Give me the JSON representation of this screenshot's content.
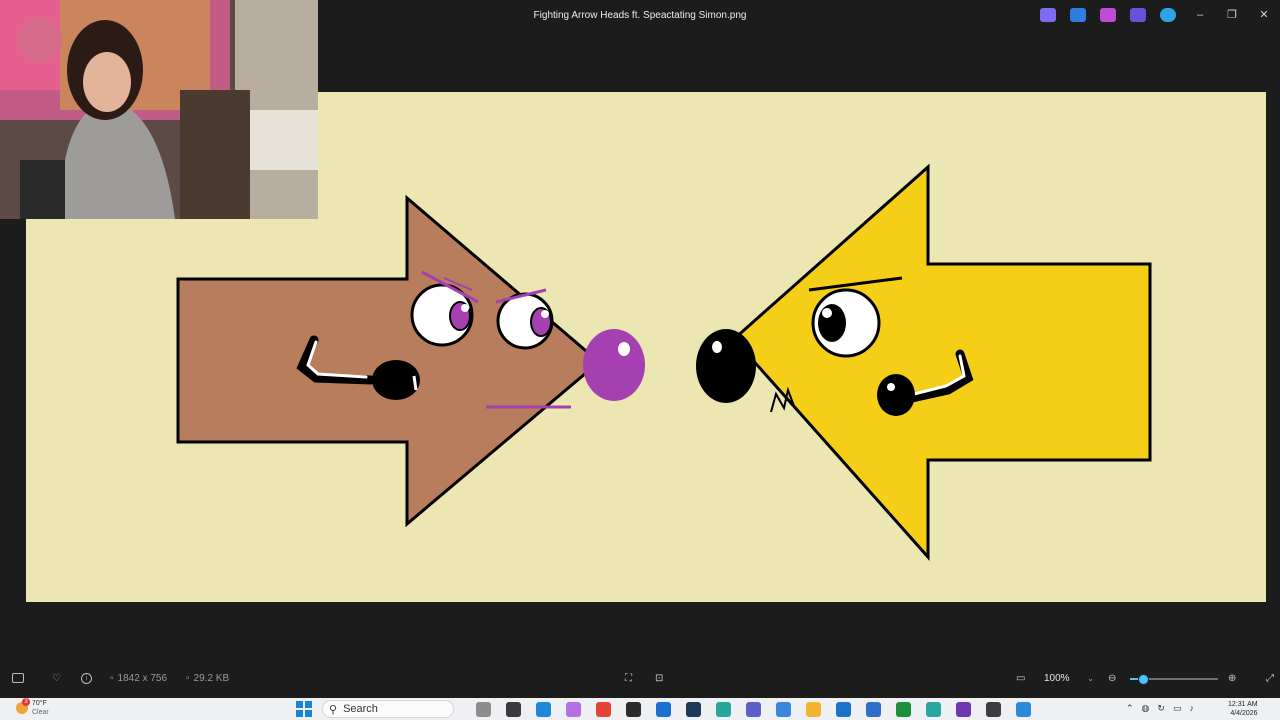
{
  "window": {
    "title": "Fighting Arrow Heads ft. Speactating Simon.png",
    "controls": [
      "minimize",
      "restore",
      "close"
    ]
  },
  "title_apps": [
    {
      "icon": "copilot-icon",
      "color": "#7e6cf0"
    },
    {
      "icon": "edit-icon",
      "color": "#2f7de1"
    },
    {
      "icon": "designer-icon",
      "color": "#c04bd8"
    },
    {
      "icon": "clipchamp-icon",
      "color": "#6b4fd8"
    },
    {
      "icon": "onedrive-icon",
      "color": "#2fa3e6"
    }
  ],
  "image": {
    "background": "#ece6b2",
    "brown_arrow_color": "#b77d5c",
    "yellow_arrow_color": "#f5cf17",
    "purple_accent": "#a540b0",
    "yellow_arrow_mark": "M"
  },
  "status": {
    "dimensions": "1842 x 756",
    "file_size": "29.2 KB",
    "zoom": "100%",
    "zoom_level": 0.14
  },
  "taskbar": {
    "weather_temp": "70°F",
    "weather_cond": "Clear",
    "weather_badge": "3",
    "search_placeholder": "Search",
    "pinned": [
      {
        "name": "widget-icon",
        "color": "#8d8d8d"
      },
      {
        "name": "task-view-icon",
        "color": "#3a3a3a"
      },
      {
        "name": "edge-icon",
        "color": "#1f87d6"
      },
      {
        "name": "copilot-icon",
        "color": "#b46ee6"
      },
      {
        "name": "chrome-icon",
        "color": "#e2443a"
      },
      {
        "name": "epic-icon",
        "color": "#2b2b2b"
      },
      {
        "name": "azure-icon",
        "color": "#1d6fcf"
      },
      {
        "name": "steam-icon",
        "color": "#1b3a5b"
      },
      {
        "name": "teal-app-icon",
        "color": "#27a79a"
      },
      {
        "name": "teams-icon",
        "color": "#5b5fc7"
      },
      {
        "name": "heart-app-icon",
        "color": "#3a86d8"
      },
      {
        "name": "file-explorer-icon",
        "color": "#f2b531"
      },
      {
        "name": "mail-icon",
        "color": "#1a73c9"
      },
      {
        "name": "store-icon",
        "color": "#2d6fc9"
      },
      {
        "name": "xbox-icon",
        "color": "#1d8f3a"
      },
      {
        "name": "globe-app-icon",
        "color": "#2aa6a0"
      },
      {
        "name": "onenote-icon",
        "color": "#7038b0"
      },
      {
        "name": "obs-icon",
        "color": "#3d3d3d"
      },
      {
        "name": "photos-icon",
        "color": "#2d8ad6"
      }
    ],
    "time": "12:31 AM",
    "date": "4/4/2026"
  }
}
